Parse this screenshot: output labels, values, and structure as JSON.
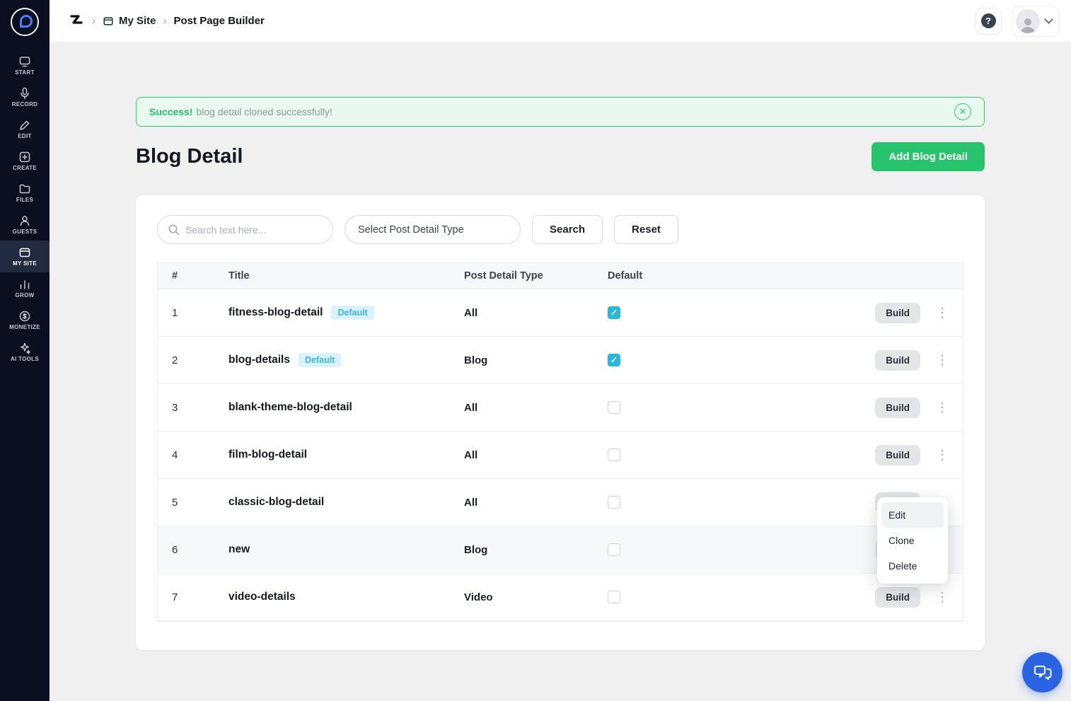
{
  "sidebar": {
    "items": [
      {
        "label": "START"
      },
      {
        "label": "RECORD"
      },
      {
        "label": "EDIT"
      },
      {
        "label": "CREATE"
      },
      {
        "label": "FILES"
      },
      {
        "label": "GUESTS"
      },
      {
        "label": "MY SITE",
        "active": true
      },
      {
        "label": "GROW"
      },
      {
        "label": "MONETIZE"
      },
      {
        "label": "AI TOOLS"
      }
    ]
  },
  "header": {
    "breadcrumb_site": "My Site",
    "breadcrumb_page": "Post Page Builder",
    "help_glyph": "?"
  },
  "alert": {
    "title": "Success!",
    "message": "blog detail cloned successfully!"
  },
  "page": {
    "title": "Blog Detail",
    "add_button_label": "Add Blog Detail"
  },
  "filters": {
    "search_placeholder": "Search text here...",
    "type_select_value": "Select Post Detail Type",
    "search_button_label": "Search",
    "reset_button_label": "Reset"
  },
  "table": {
    "headers": {
      "num": "#",
      "title": "Title",
      "type": "Post Detail Type",
      "default": "Default"
    },
    "build_label": "Build",
    "rows": [
      {
        "num": "1",
        "title": "fitness-blog-detail",
        "badge": "Default",
        "type": "All",
        "default": true
      },
      {
        "num": "2",
        "title": "blog-details",
        "badge": "Default",
        "type": "Blog",
        "default": true
      },
      {
        "num": "3",
        "title": "blank-theme-blog-detail",
        "type": "All",
        "default": false
      },
      {
        "num": "4",
        "title": "film-blog-detail",
        "type": "All",
        "default": false
      },
      {
        "num": "5",
        "title": "classic-blog-detail",
        "type": "All",
        "default": false
      },
      {
        "num": "6",
        "title": "new",
        "type": "Blog",
        "default": false
      },
      {
        "num": "7",
        "title": "video-details",
        "type": "Video",
        "default": false
      }
    ]
  },
  "context_menu": {
    "items": [
      "Edit",
      "Clone",
      "Delete"
    ]
  },
  "colors": {
    "accent_green": "#27c36d",
    "success_border": "#2ecc71",
    "badge_blue": "#3cb4de",
    "checkbox_teal": "#2cb5da",
    "chat_blue": "#2b64e3",
    "sidebar_bg": "#0b0f1f"
  }
}
